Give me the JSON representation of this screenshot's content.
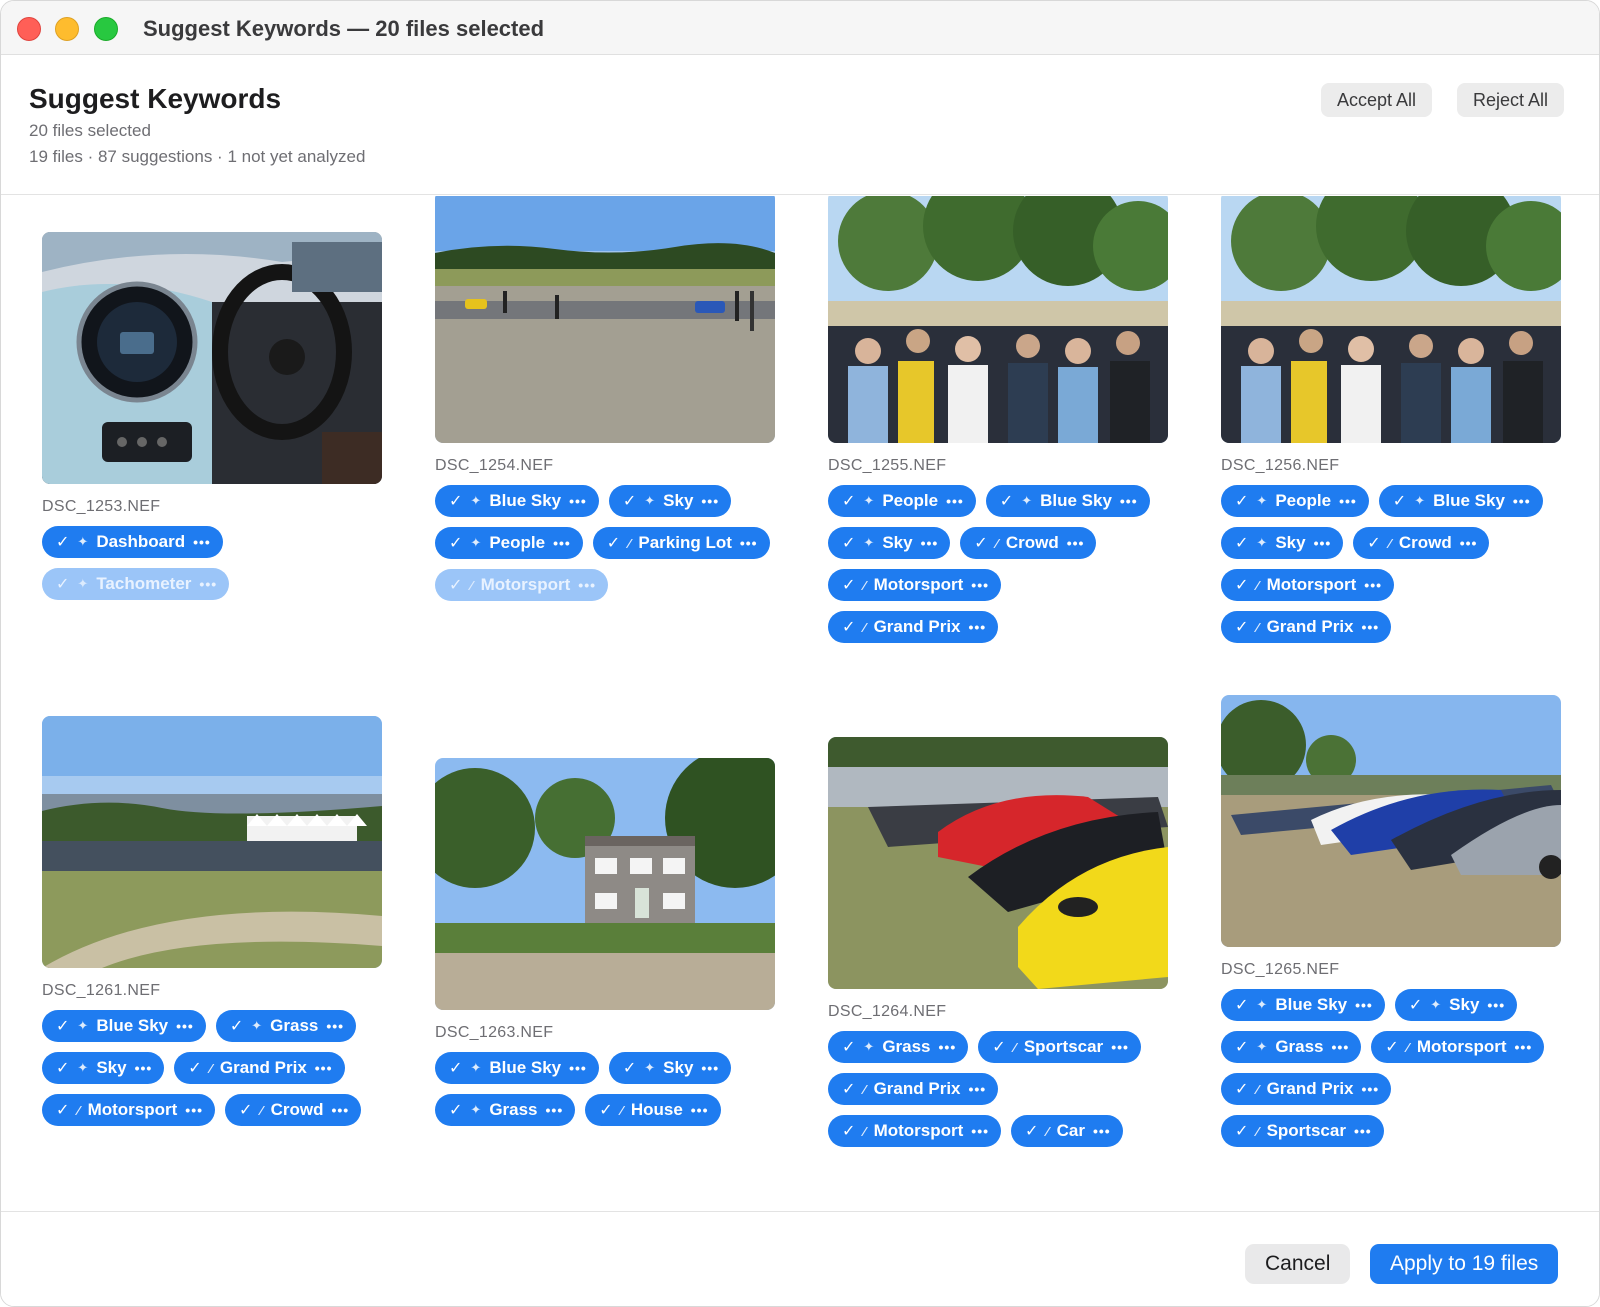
{
  "window": {
    "title": "Suggest Keywords — 20 files selected"
  },
  "header": {
    "title": "Suggest Keywords",
    "selected": "20 files selected",
    "summary": "19 files · 87 suggestions · 1 not yet analyzed",
    "accept_all": "Accept All",
    "reject_all": "Reject All"
  },
  "check_glyph": "✓",
  "dots_glyph": "•••",
  "icons": {
    "sparkle": "sparkle-icon",
    "wand": "magic-wand-icon"
  },
  "files": [
    {
      "name": "DSC_1253.NEF",
      "image": "car-dashboard",
      "keywords": [
        {
          "label": "Dashboard",
          "icon": "sparkle",
          "dim": false
        },
        {
          "label": "Tachometer",
          "icon": "sparkle",
          "dim": true
        }
      ]
    },
    {
      "name": "DSC_1254.NEF",
      "image": "parking-field",
      "keywords": [
        {
          "label": "Blue Sky",
          "icon": "sparkle",
          "dim": false
        },
        {
          "label": "Sky",
          "icon": "sparkle",
          "dim": false
        },
        {
          "label": "People",
          "icon": "sparkle",
          "dim": false
        },
        {
          "label": "Parking Lot",
          "icon": "wand",
          "dim": false
        },
        {
          "label": "Motorsport",
          "icon": "wand",
          "dim": true
        }
      ]
    },
    {
      "name": "DSC_1255.NEF",
      "image": "crowd-trees",
      "keywords": [
        {
          "label": "People",
          "icon": "sparkle",
          "dim": false
        },
        {
          "label": "Blue Sky",
          "icon": "sparkle",
          "dim": false
        },
        {
          "label": "Sky",
          "icon": "sparkle",
          "dim": false
        },
        {
          "label": "Crowd",
          "icon": "wand",
          "dim": false
        },
        {
          "label": "Motorsport",
          "icon": "wand",
          "dim": false
        },
        {
          "label": "Grand Prix",
          "icon": "wand",
          "dim": false
        }
      ]
    },
    {
      "name": "DSC_1256.NEF",
      "image": "crowd-trees",
      "keywords": [
        {
          "label": "People",
          "icon": "sparkle",
          "dim": false
        },
        {
          "label": "Blue Sky",
          "icon": "sparkle",
          "dim": false
        },
        {
          "label": "Sky",
          "icon": "sparkle",
          "dim": false
        },
        {
          "label": "Crowd",
          "icon": "wand",
          "dim": false
        },
        {
          "label": "Motorsport",
          "icon": "wand",
          "dim": false
        },
        {
          "label": "Grand Prix",
          "icon": "wand",
          "dim": false
        }
      ]
    },
    {
      "name": "DSC_1261.NEF",
      "image": "tents-field",
      "keywords": [
        {
          "label": "Blue Sky",
          "icon": "sparkle",
          "dim": false
        },
        {
          "label": "Grass",
          "icon": "sparkle",
          "dim": false
        },
        {
          "label": "Sky",
          "icon": "sparkle",
          "dim": false
        },
        {
          "label": "Grand Prix",
          "icon": "wand",
          "dim": false
        },
        {
          "label": "Motorsport",
          "icon": "wand",
          "dim": false
        },
        {
          "label": "Crowd",
          "icon": "wand",
          "dim": false
        }
      ]
    },
    {
      "name": "DSC_1263.NEF",
      "image": "flint-house",
      "keywords": [
        {
          "label": "Blue Sky",
          "icon": "sparkle",
          "dim": false
        },
        {
          "label": "Sky",
          "icon": "sparkle",
          "dim": false
        },
        {
          "label": "Grass",
          "icon": "sparkle",
          "dim": false
        },
        {
          "label": "House",
          "icon": "wand",
          "dim": false
        }
      ]
    },
    {
      "name": "DSC_1264.NEF",
      "image": "sportscars-row",
      "keywords": [
        {
          "label": "Grass",
          "icon": "sparkle",
          "dim": false
        },
        {
          "label": "Sportscar",
          "icon": "wand",
          "dim": false
        },
        {
          "label": "Grand Prix",
          "icon": "wand",
          "dim": false
        },
        {
          "label": "Motorsport",
          "icon": "wand",
          "dim": false
        },
        {
          "label": "Car",
          "icon": "wand",
          "dim": false
        }
      ]
    },
    {
      "name": "DSC_1265.NEF",
      "image": "mustangs-row",
      "keywords": [
        {
          "label": "Blue Sky",
          "icon": "sparkle",
          "dim": false
        },
        {
          "label": "Sky",
          "icon": "sparkle",
          "dim": false
        },
        {
          "label": "Grass",
          "icon": "sparkle",
          "dim": false
        },
        {
          "label": "Motorsport",
          "icon": "wand",
          "dim": false
        },
        {
          "label": "Grand Prix",
          "icon": "wand",
          "dim": false
        },
        {
          "label": "Sportscar",
          "icon": "wand",
          "dim": false
        }
      ]
    }
  ],
  "footer": {
    "cancel": "Cancel",
    "apply": "Apply to 19 files"
  },
  "colors": {
    "accent": "#1f7cf0",
    "accent_dim": "#9bc5f8"
  }
}
